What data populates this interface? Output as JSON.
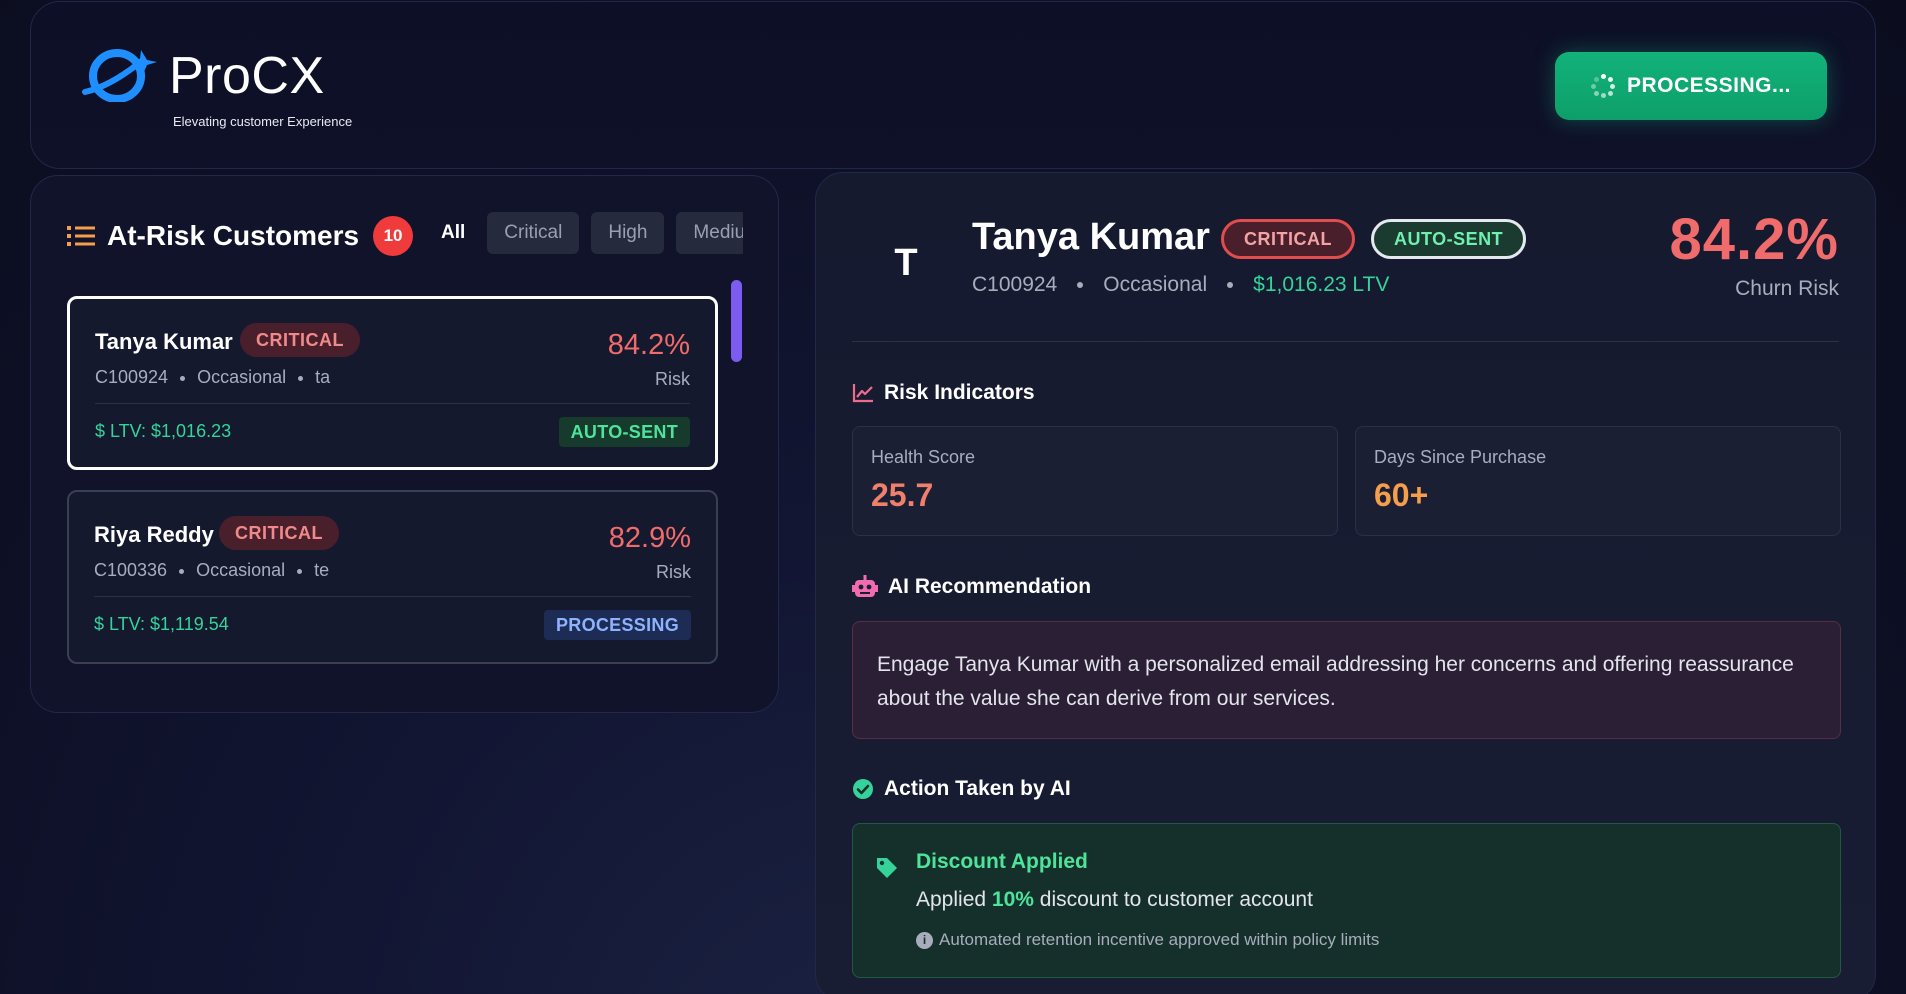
{
  "brand": {
    "title": "ProCX",
    "tagline": "Elevating customer Experience",
    "accent": "#1f8fff"
  },
  "header": {
    "processing_label": "PROCESSING...",
    "processing_color": "#10b981"
  },
  "list": {
    "title": "At-Risk Customers",
    "count": "10",
    "filters": [
      "All",
      "Critical",
      "High",
      "Medium"
    ],
    "risk_label": "Risk",
    "customers": [
      {
        "name": "Tanya Kumar",
        "severity": "CRITICAL",
        "id": "C100924",
        "segment": "Occasional",
        "extra": "ta",
        "risk": "84.2%",
        "ltv": "$ LTV: $1,016.23",
        "status": "AUTO-SENT"
      },
      {
        "name": "Riya Reddy",
        "severity": "CRITICAL",
        "id": "C100336",
        "segment": "Occasional",
        "extra": "te",
        "risk": "82.9%",
        "ltv": "$ LTV: $1,119.54",
        "status": "PROCESSING"
      }
    ]
  },
  "detail": {
    "avatar_initial": "T",
    "name": "Tanya Kumar",
    "severity": "CRITICAL",
    "status": "AUTO-SENT",
    "id": "C100924",
    "segment": "Occasional",
    "ltv": "$1,016.23 LTV",
    "churn_value": "84.2%",
    "churn_label": "Churn Risk",
    "risk_indicators_title": "Risk Indicators",
    "metrics": [
      {
        "label": "Health Score",
        "value": "25.7"
      },
      {
        "label": "Days Since Purchase",
        "value": "60+"
      }
    ],
    "ai_title": "AI Recommendation",
    "ai_text": "Engage Tanya Kumar with a personalized email addressing her concerns and offering reassurance about the value she can derive from our services.",
    "action_title": "Action Taken by AI",
    "action_heading": "Discount Applied",
    "action_pre": "Applied",
    "action_pct": "10%",
    "action_post": "discount to customer account",
    "action_note": "Automated retention incentive approved within policy limits"
  }
}
